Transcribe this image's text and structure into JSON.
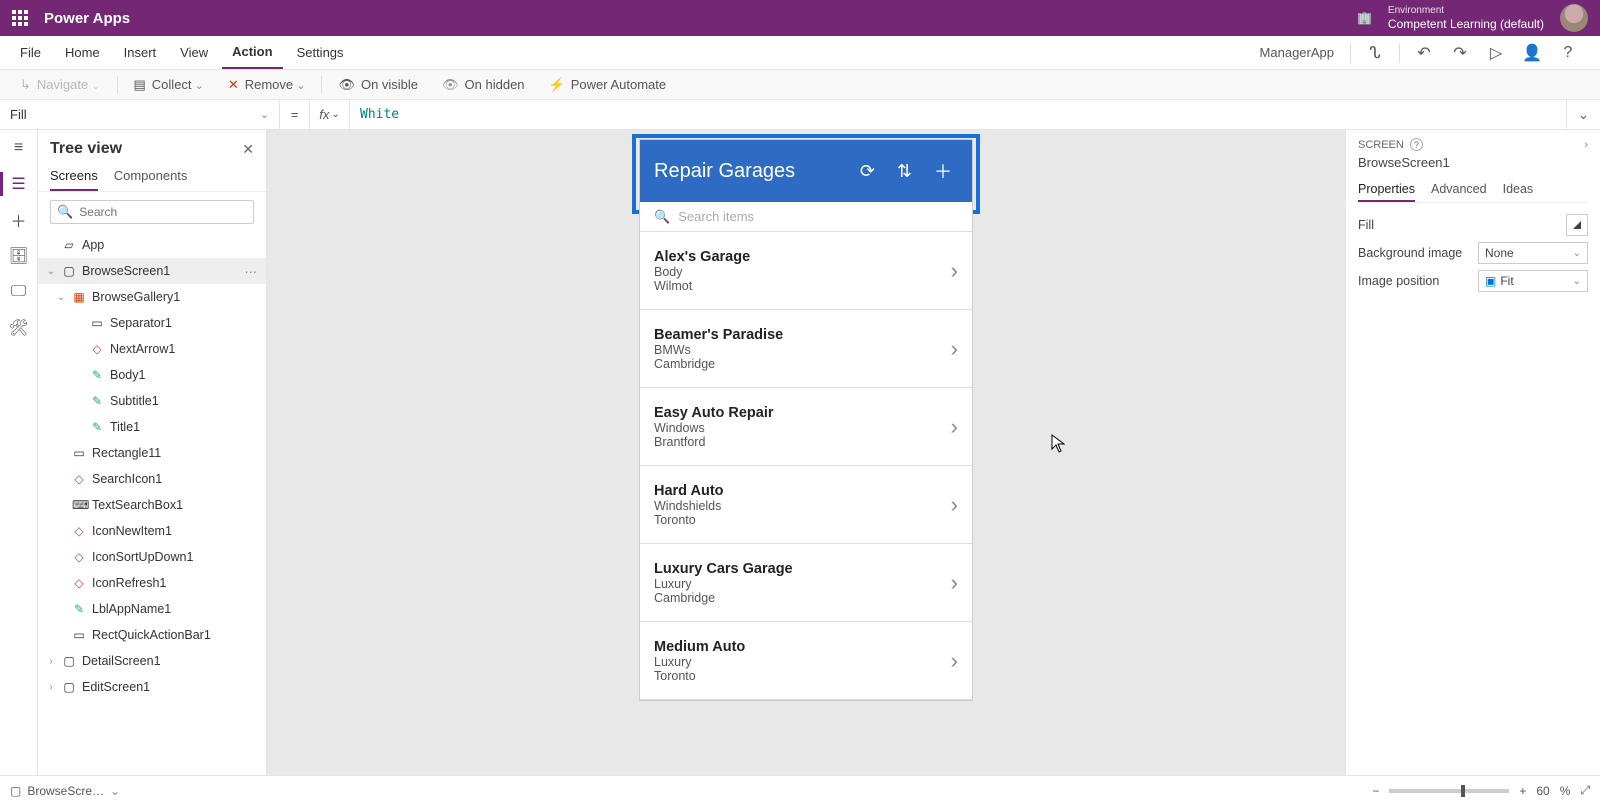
{
  "brand": "Power Apps",
  "environment": {
    "label": "Environment",
    "value": "Competent Learning (default)"
  },
  "menu": {
    "items": [
      "File",
      "Home",
      "Insert",
      "View",
      "Action",
      "Settings"
    ],
    "active": "Action",
    "appName": "ManagerApp"
  },
  "ribbon": {
    "navigate": "Navigate",
    "collect": "Collect",
    "remove": "Remove",
    "onVisible": "On visible",
    "onHidden": "On hidden",
    "powerAutomate": "Power Automate"
  },
  "formula": {
    "property": "Fill",
    "eq": "=",
    "fx": "fx",
    "value": "White"
  },
  "tree": {
    "title": "Tree view",
    "tabs": [
      "Screens",
      "Components"
    ],
    "activeTab": "Screens",
    "searchPlaceholder": "Search",
    "nodes": {
      "app": "App",
      "browseScreen": "BrowseScreen1",
      "browseGallery": "BrowseGallery1",
      "separator": "Separator1",
      "nextArrow": "NextArrow1",
      "body": "Body1",
      "subtitle": "Subtitle1",
      "titleN": "Title1",
      "rectangle": "Rectangle11",
      "searchIcon": "SearchIcon1",
      "textSearchBox": "TextSearchBox1",
      "iconNewItem": "IconNewItem1",
      "iconSortUpDown": "IconSortUpDown1",
      "iconRefresh": "IconRefresh1",
      "lblAppName": "LblAppName1",
      "rectQuick": "RectQuickActionBar1",
      "detailScreen": "DetailScreen1",
      "editScreen": "EditScreen1"
    }
  },
  "canvasApp": {
    "headerTitle": "Repair Garages",
    "searchPlaceholder": "Search items",
    "items": [
      {
        "title": "Alex's Garage",
        "sub": "Body",
        "loc": "Wilmot"
      },
      {
        "title": "Beamer's Paradise",
        "sub": "BMWs",
        "loc": "Cambridge"
      },
      {
        "title": "Easy Auto Repair",
        "sub": "Windows",
        "loc": "Brantford"
      },
      {
        "title": "Hard Auto",
        "sub": "Windshields",
        "loc": "Toronto"
      },
      {
        "title": "Luxury Cars Garage",
        "sub": "Luxury",
        "loc": "Cambridge"
      },
      {
        "title": "Medium Auto",
        "sub": "Luxury",
        "loc": "Toronto"
      }
    ]
  },
  "props": {
    "screenLabel": "SCREEN",
    "screenName": "BrowseScreen1",
    "tabs": [
      "Properties",
      "Advanced",
      "Ideas"
    ],
    "activeTab": "Properties",
    "rows": {
      "fillLabel": "Fill",
      "bgImageLabel": "Background image",
      "bgImageValue": "None",
      "imgPosLabel": "Image position",
      "imgPosValue": "Fit"
    }
  },
  "status": {
    "screenSel": "BrowseScre…",
    "zoom": "60",
    "zoomUnit": "%"
  }
}
